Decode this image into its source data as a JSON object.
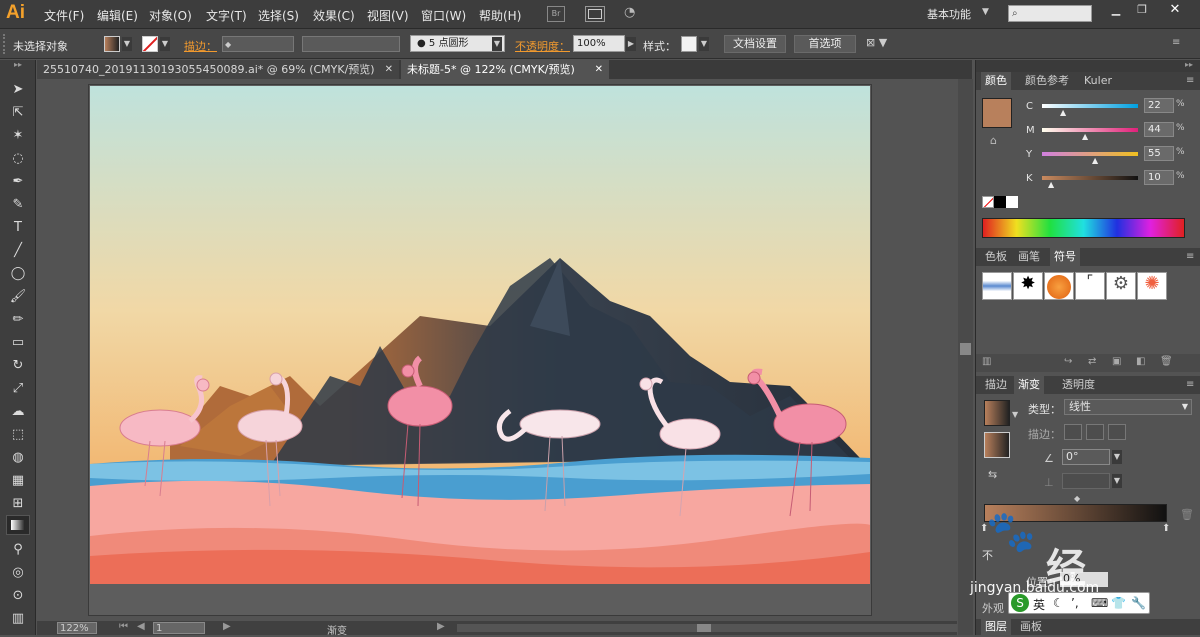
{
  "app": {
    "logo": "Ai"
  },
  "menu": [
    "文件(F)",
    "编辑(E)",
    "对象(O)",
    "文字(T)",
    "选择(S)",
    "效果(C)",
    "视图(V)",
    "窗口(W)",
    "帮助(H)"
  ],
  "workspace": "基本功能",
  "menubar_icons": [
    "bridge-icon",
    "arrange-documents-icon",
    "gpu-performance-icon"
  ],
  "control": {
    "selection": "未选择对象",
    "stroke_label": "描边：",
    "brush": "5 点圆形",
    "opacity_label": "不透明度：",
    "opacity_value": "100%",
    "style_label": "样式：",
    "doc_setup": "文档设置",
    "preferences": "首选项"
  },
  "tabs": [
    {
      "title": "25510740_20191130193055450089.ai* @ 69% (CMYK/预览)"
    },
    {
      "title": "未标题-5* @ 122% (CMYK/预览)"
    }
  ],
  "status": {
    "zoom": "122%",
    "page": "1",
    "tool": "渐变"
  },
  "color_panel": {
    "tabs": [
      "颜色",
      "颜色参考",
      "Kuler"
    ],
    "channels": [
      {
        "name": "C",
        "value": "22"
      },
      {
        "name": "M",
        "value": "44"
      },
      {
        "name": "Y",
        "value": "55"
      },
      {
        "name": "K",
        "value": "10"
      }
    ],
    "fill": "#b8805c"
  },
  "swatch_panel": {
    "tabs": [
      "色板",
      "画笔",
      "符号"
    ]
  },
  "gradient_panel": {
    "tabs": [
      "描边",
      "渐变",
      "透明度"
    ],
    "type_label": "类型：",
    "type_value": "线性",
    "stroke_label": "描边：",
    "angle": "0°",
    "location_label": "位置：",
    "location_value": "0%",
    "opacity_prefix": "不"
  },
  "layers_panel": {
    "tabs": [
      "图层",
      "画板"
    ]
  },
  "appearance_label": "外观",
  "watermark": {
    "text": "经",
    "url": "jingyan.baidu.com",
    "ime": "英"
  },
  "colors": {
    "sky_top": "#bfe2dc",
    "sky_bottom": "#f2a14e",
    "mountain": "#2e3a48",
    "water": "#4a9ed0",
    "sand": "#f7a7a0",
    "sand_dark": "#ec6e58",
    "flamingo": "#f28fa6"
  }
}
